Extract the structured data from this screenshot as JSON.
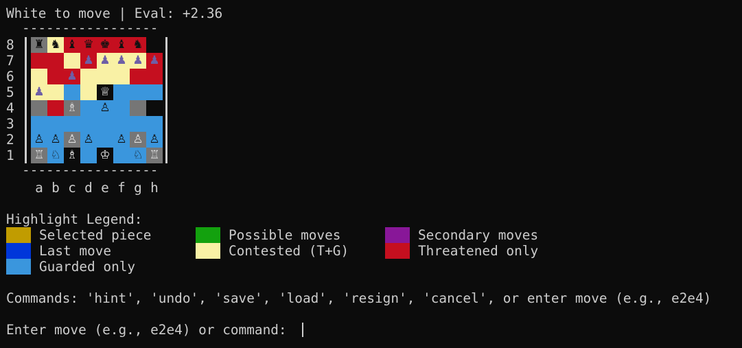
{
  "status_line": "White to move | Eval: +2.36",
  "board": {
    "border_dashes": "-----------------",
    "files": [
      "a",
      "b",
      "c",
      "d",
      "e",
      "f",
      "g",
      "h"
    ],
    "ranks": [
      {
        "label": "8",
        "squares": [
          {
            "color": "#767676",
            "piece": "♜",
            "piece_color": "#111111"
          },
          {
            "color": "#f9f1a5",
            "piece": "♞",
            "piece_color": "#111111"
          },
          {
            "color": "#c50f1f",
            "piece": "♝",
            "piece_color": "#111111"
          },
          {
            "color": "#c50f1f",
            "piece": "♛",
            "piece_color": "#111111"
          },
          {
            "color": "#c50f1f",
            "piece": "♚",
            "piece_color": "#111111"
          },
          {
            "color": "#c50f1f",
            "piece": "♝",
            "piece_color": "#111111"
          },
          {
            "color": "#c50f1f",
            "piece": "♞",
            "piece_color": "#111111"
          },
          {
            "color": "#0c0c0c",
            "piece": "",
            "piece_color": "#111111"
          }
        ]
      },
      {
        "label": "7",
        "squares": [
          {
            "color": "#c50f1f",
            "piece": "",
            "piece_color": "#6e5fa6"
          },
          {
            "color": "#c50f1f",
            "piece": "",
            "piece_color": "#6e5fa6"
          },
          {
            "color": "#f9f1a5",
            "piece": "",
            "piece_color": "#6e5fa6"
          },
          {
            "color": "#c50f1f",
            "piece": "♟",
            "piece_color": "#6e5fa6"
          },
          {
            "color": "#f9f1a5",
            "piece": "♟",
            "piece_color": "#6e5fa6"
          },
          {
            "color": "#f9f1a5",
            "piece": "♟",
            "piece_color": "#6e5fa6"
          },
          {
            "color": "#f9f1a5",
            "piece": "♟",
            "piece_color": "#6e5fa6"
          },
          {
            "color": "#c50f1f",
            "piece": "♟",
            "piece_color": "#6e5fa6"
          }
        ]
      },
      {
        "label": "6",
        "squares": [
          {
            "color": "#f9f1a5",
            "piece": "",
            "piece_color": "#6e5fa6"
          },
          {
            "color": "#c50f1f",
            "piece": "",
            "piece_color": "#6e5fa6"
          },
          {
            "color": "#c50f1f",
            "piece": "♟",
            "piece_color": "#6e5fa6"
          },
          {
            "color": "#f9f1a5",
            "piece": "",
            "piece_color": "#6e5fa6"
          },
          {
            "color": "#f9f1a5",
            "piece": "",
            "piece_color": "#6e5fa6"
          },
          {
            "color": "#f9f1a5",
            "piece": "",
            "piece_color": "#6e5fa6"
          },
          {
            "color": "#c50f1f",
            "piece": "",
            "piece_color": "#6e5fa6"
          },
          {
            "color": "#c50f1f",
            "piece": "",
            "piece_color": "#6e5fa6"
          }
        ]
      },
      {
        "label": "5",
        "squares": [
          {
            "color": "#f9f1a5",
            "piece": "♟",
            "piece_color": "#6e5fa6"
          },
          {
            "color": "#f9f1a5",
            "piece": "",
            "piece_color": "#6e5fa6"
          },
          {
            "color": "#3a96dd",
            "piece": "",
            "piece_color": "#6e5fa6"
          },
          {
            "color": "#f9f1a5",
            "piece": "",
            "piece_color": "#6e5fa6"
          },
          {
            "color": "#0c0c0c",
            "piece": "♕",
            "piece_color": "#f2f2f2"
          },
          {
            "color": "#3a96dd",
            "piece": "",
            "piece_color": "#6e5fa6"
          },
          {
            "color": "#3a96dd",
            "piece": "",
            "piece_color": "#6e5fa6"
          },
          {
            "color": "#3a96dd",
            "piece": "",
            "piece_color": "#6e5fa6"
          }
        ]
      },
      {
        "label": "4",
        "squares": [
          {
            "color": "#767676",
            "piece": "",
            "piece_color": "#111111"
          },
          {
            "color": "#c50f1f",
            "piece": "",
            "piece_color": "#111111"
          },
          {
            "color": "#767676",
            "piece": "♗",
            "piece_color": "#e0e0e0"
          },
          {
            "color": "#3a96dd",
            "piece": "",
            "piece_color": "#111111"
          },
          {
            "color": "#3a96dd",
            "piece": "♙",
            "piece_color": "#111111"
          },
          {
            "color": "#3a96dd",
            "piece": "",
            "piece_color": "#111111"
          },
          {
            "color": "#767676",
            "piece": "",
            "piece_color": "#111111"
          },
          {
            "color": "#0c0c0c",
            "piece": "",
            "piece_color": "#111111"
          }
        ]
      },
      {
        "label": "3",
        "squares": [
          {
            "color": "#3a96dd",
            "piece": "",
            "piece_color": "#111111"
          },
          {
            "color": "#3a96dd",
            "piece": "",
            "piece_color": "#111111"
          },
          {
            "color": "#3a96dd",
            "piece": "",
            "piece_color": "#111111"
          },
          {
            "color": "#3a96dd",
            "piece": "",
            "piece_color": "#111111"
          },
          {
            "color": "#3a96dd",
            "piece": "",
            "piece_color": "#111111"
          },
          {
            "color": "#3a96dd",
            "piece": "",
            "piece_color": "#111111"
          },
          {
            "color": "#3a96dd",
            "piece": "",
            "piece_color": "#111111"
          },
          {
            "color": "#3a96dd",
            "piece": "",
            "piece_color": "#111111"
          }
        ]
      },
      {
        "label": "2",
        "squares": [
          {
            "color": "#3a96dd",
            "piece": "♙",
            "piece_color": "#111111"
          },
          {
            "color": "#3a96dd",
            "piece": "♙",
            "piece_color": "#111111"
          },
          {
            "color": "#767676",
            "piece": "♙",
            "piece_color": "#e0e0e0"
          },
          {
            "color": "#3a96dd",
            "piece": "♙",
            "piece_color": "#111111"
          },
          {
            "color": "#3a96dd",
            "piece": "",
            "piece_color": "#111111"
          },
          {
            "color": "#3a96dd",
            "piece": "♙",
            "piece_color": "#111111"
          },
          {
            "color": "#767676",
            "piece": "♙",
            "piece_color": "#e0e0e0"
          },
          {
            "color": "#3a96dd",
            "piece": "♙",
            "piece_color": "#111111"
          }
        ]
      },
      {
        "label": "1",
        "squares": [
          {
            "color": "#767676",
            "piece": "♖",
            "piece_color": "#e0e0e0"
          },
          {
            "color": "#3a96dd",
            "piece": "♘",
            "piece_color": "#111111"
          },
          {
            "color": "#0c0c0c",
            "piece": "♗",
            "piece_color": "#f2f2f2"
          },
          {
            "color": "#3a96dd",
            "piece": "",
            "piece_color": "#111111"
          },
          {
            "color": "#0c0c0c",
            "piece": "♔",
            "piece_color": "#f2f2f2"
          },
          {
            "color": "#3a96dd",
            "piece": "",
            "piece_color": "#111111"
          },
          {
            "color": "#3a96dd",
            "piece": "♘",
            "piece_color": "#111111"
          },
          {
            "color": "#767676",
            "piece": "♖",
            "piece_color": "#e0e0e0"
          }
        ]
      }
    ]
  },
  "legend": {
    "title": "Highlight Legend:",
    "items": [
      {
        "label": "Selected piece",
        "color": "#c19c00"
      },
      {
        "label": "Last move",
        "color": "#0037da"
      },
      {
        "label": "Guarded only",
        "color": "#3a96dd"
      },
      {
        "label": "Possible moves",
        "color": "#13a10e"
      },
      {
        "label": "Contested (T+G)",
        "color": "#f9f1a5"
      },
      {
        "label": "Secondary moves",
        "color": "#881798"
      },
      {
        "label": "Threatened only",
        "color": "#c50f1f"
      }
    ]
  },
  "commands_line": "Commands: 'hint', 'undo', 'save', 'load', 'resign', 'cancel', or enter move (e.g., e2e4)",
  "prompt": "Enter move (e.g., e2e4) or command: "
}
